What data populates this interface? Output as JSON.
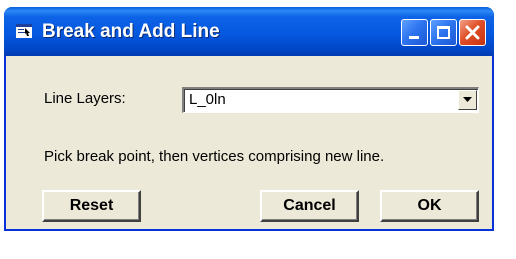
{
  "window": {
    "title": "Break and Add Line"
  },
  "titlebar_buttons": {
    "minimize": "minimize-icon",
    "maximize": "maximize-icon",
    "close": "close-icon"
  },
  "form": {
    "line_layers_label": "Line Layers:",
    "line_layers_value": "L_0ln",
    "instruction": "Pick break point, then vertices comprising new line."
  },
  "buttons": {
    "reset": "Reset",
    "cancel": "Cancel",
    "ok": "OK"
  },
  "colors": {
    "titlebar": "#0558e0",
    "window_bg": "#ece9d8",
    "close_button": "#e0502a"
  }
}
